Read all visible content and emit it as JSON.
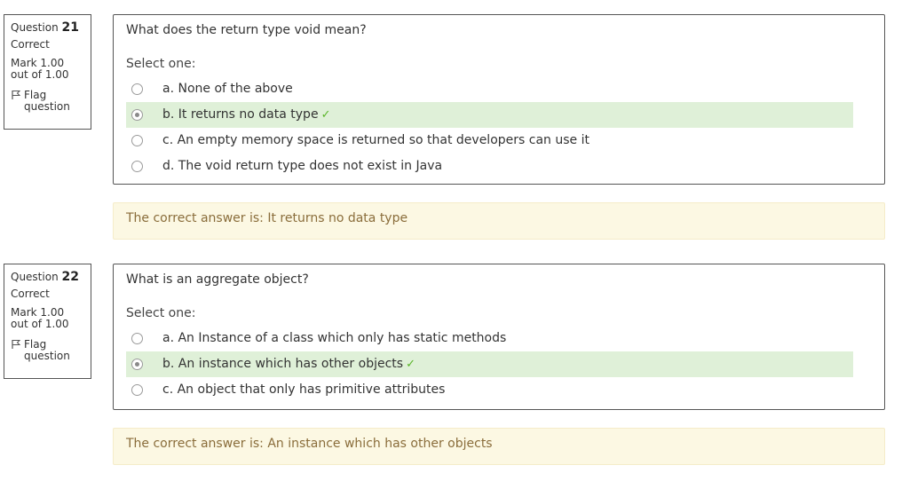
{
  "questions": [
    {
      "number_prefix": "Question",
      "number": "21",
      "state": "Correct",
      "grade": "Mark 1.00 out of 1.00",
      "flag_label": "Flag question",
      "text": "What does the return type void mean?",
      "prompt": "Select one:",
      "options": [
        {
          "label": "a. None of the above",
          "selected": false,
          "correct": false
        },
        {
          "label": "b. It returns no data type",
          "selected": true,
          "correct": true
        },
        {
          "label": "c. An empty memory space is returned so that developers can use it",
          "selected": false,
          "correct": false
        },
        {
          "label": "d. The void return type does not exist in Java",
          "selected": false,
          "correct": false
        }
      ],
      "feedback": "The correct answer is: It returns no data type"
    },
    {
      "number_prefix": "Question",
      "number": "22",
      "state": "Correct",
      "grade": "Mark 1.00 out of 1.00",
      "flag_label": "Flag question",
      "text": "What is an aggregate object?",
      "prompt": "Select one:",
      "options": [
        {
          "label": "a. An Instance of a class which only has static methods",
          "selected": false,
          "correct": false
        },
        {
          "label": "b. An instance which has other objects",
          "selected": true,
          "correct": true
        },
        {
          "label": "c. An object that only has primitive attributes",
          "selected": false,
          "correct": false
        }
      ],
      "feedback": "The correct answer is: An instance which has other objects"
    }
  ],
  "colors": {
    "correct_bg": "#dff0d8",
    "feedback_bg": "#fcf8e3",
    "feedback_text": "#8a6d3b",
    "tick": "#5ab529"
  },
  "icons": {
    "flag": "flag-icon",
    "tick": "check-icon"
  }
}
